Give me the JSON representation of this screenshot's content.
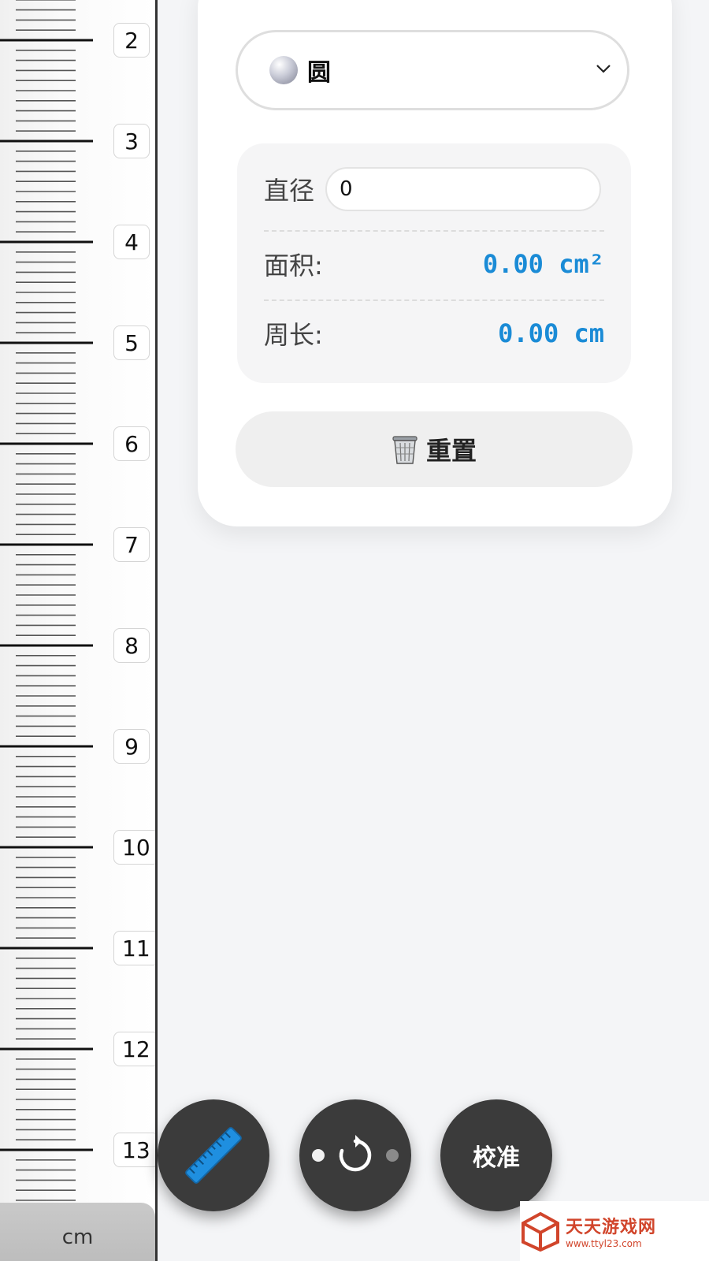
{
  "ruler": {
    "unit": "cm",
    "labels": [
      "2",
      "3",
      "4",
      "5",
      "6",
      "7",
      "8",
      "9",
      "10",
      "11",
      "12",
      "13"
    ]
  },
  "shape_selector": {
    "selected": "圆",
    "icon": "sphere-icon"
  },
  "calculator": {
    "diameter_label": "直径",
    "diameter_value": "0",
    "area_label": "面积:",
    "area_value": "0.00 cm²",
    "perimeter_label": "周长:",
    "perimeter_value": "0.00 cm",
    "value_color": "#1a8bd6"
  },
  "reset_button": {
    "label": "重置",
    "icon": "trash-icon"
  },
  "fab": {
    "ruler_icon": "ruler-icon",
    "rotate_icon": "rotate-icon",
    "calibrate_label": "校准"
  },
  "watermark": {
    "title": "天天游戏网",
    "url": "www.ttyl23.com"
  }
}
